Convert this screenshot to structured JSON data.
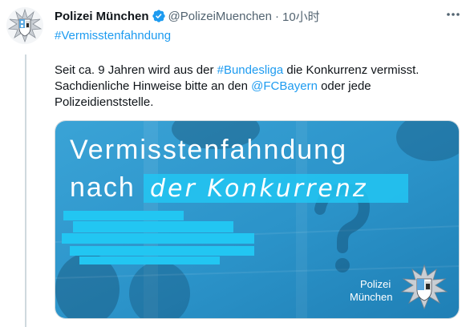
{
  "tweet": {
    "author_name": "Polizei München",
    "handle": "@PolizeiMuenchen",
    "separator": "·",
    "time": "10小时",
    "hashtag": "#Vermisstenfahndung",
    "body": {
      "l1_pre": "Seit ca. 9 Jahren wird aus der ",
      "l1_tag": "#Bundesliga",
      "l1_post": " die Konkurrenz vermisst.",
      "l2_pre": "Sachdienliche Hinweise bitte an den ",
      "l2_mention": "@FCBayern",
      "l2_post": " oder jede",
      "l3": "Polizeidienststelle."
    },
    "media": {
      "title_line1": "Vermisstenfahndung",
      "title_line2_prefix": "nach",
      "title_line2_handwritten": "der Konkurrenz",
      "footer_line1": "Polizei",
      "footer_line2": "München"
    }
  },
  "icons": {
    "avatar": "police-star-badge-icon",
    "verified": "verified-badge-icon",
    "more": "more-options-icon",
    "media_logo": "police-star-badge-icon"
  },
  "colors": {
    "accent": "#1d9bf0",
    "media_blue": "#2b93c9",
    "highlight_cyan": "#22c6f2"
  }
}
